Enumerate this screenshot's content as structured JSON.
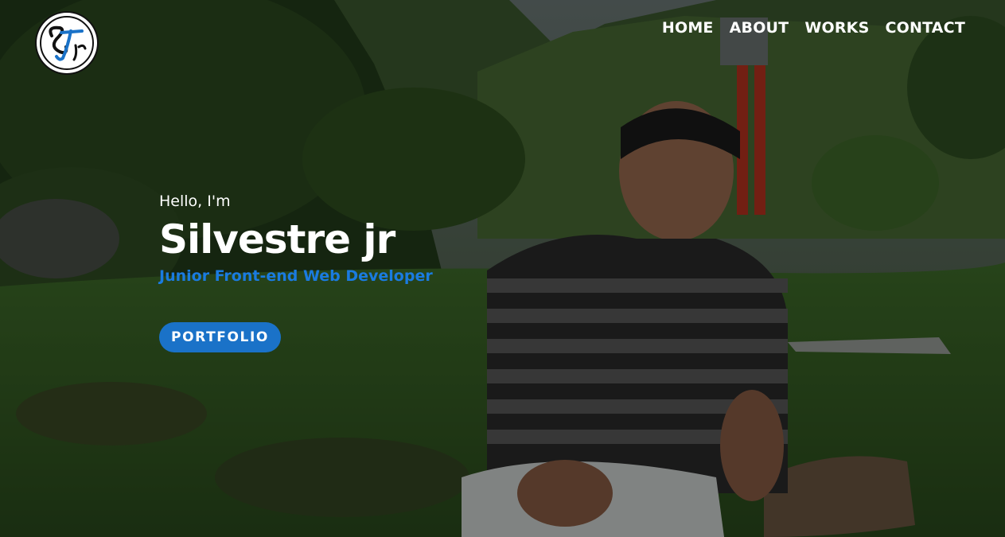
{
  "logo": {
    "text": "STjr",
    "icon": "stjr-logo-icon"
  },
  "nav": {
    "items": [
      {
        "label": "HOME"
      },
      {
        "label": "ABOUT"
      },
      {
        "label": "WORKS"
      },
      {
        "label": "CONTACT"
      }
    ]
  },
  "hero": {
    "greeting": "Hello, I'm",
    "name": "Silvestre jr",
    "role": "Junior Front-end Web Developer",
    "cta_label": "PORTFOLIO"
  },
  "colors": {
    "accent": "#1a7be0",
    "button": "#1a72c8",
    "text": "#ffffff"
  }
}
